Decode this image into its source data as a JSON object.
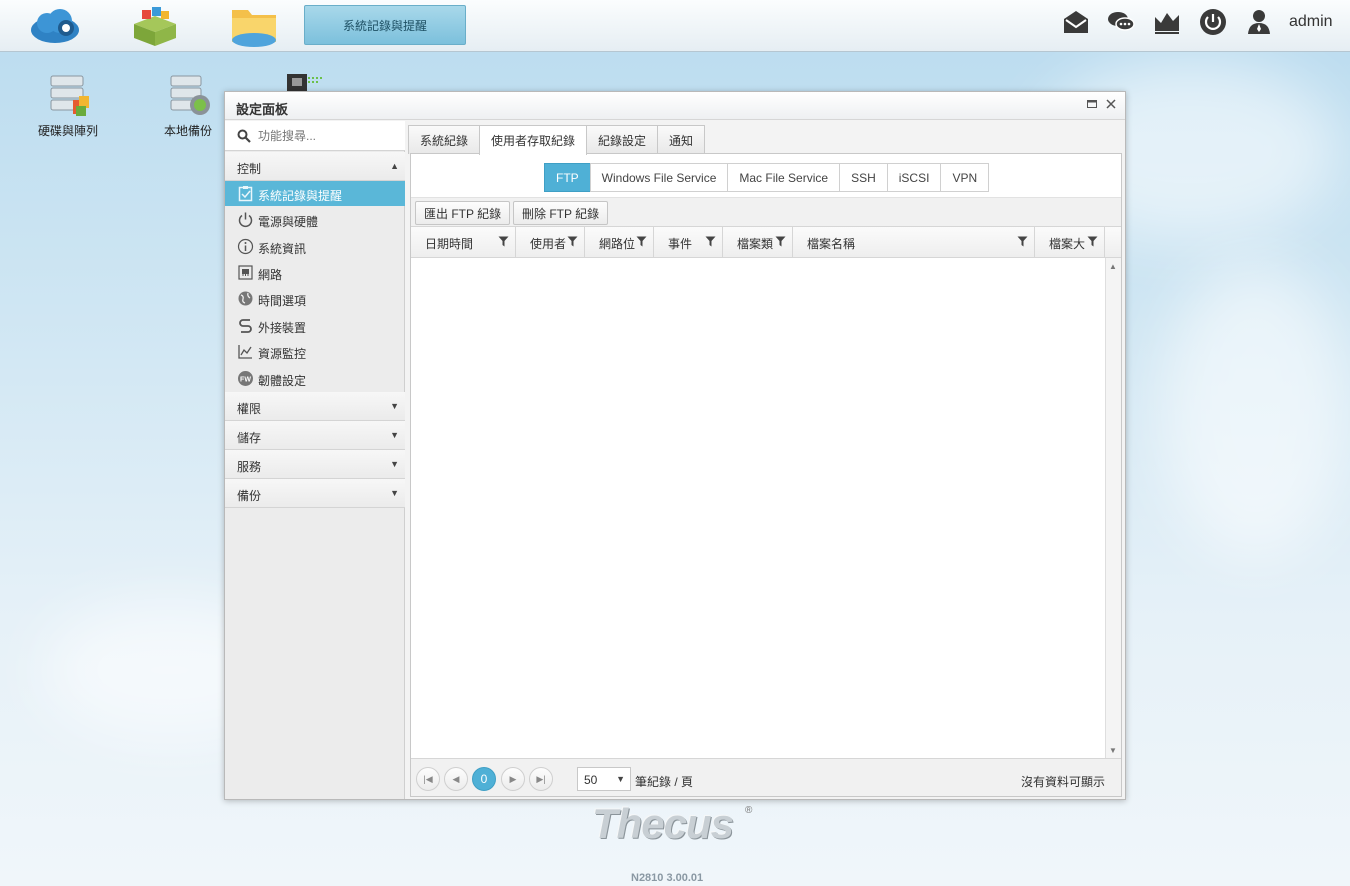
{
  "taskbar": {
    "apps": [
      {
        "name": "cloud-app-icon"
      },
      {
        "name": "app-center-icon"
      },
      {
        "name": "file-center-icon"
      }
    ],
    "active_task": "系統記錄與提醒",
    "user": "admin"
  },
  "desktop": {
    "icons": [
      {
        "label": "硬碟與陣列"
      },
      {
        "label": "本地備份"
      }
    ]
  },
  "window": {
    "title": "設定面板",
    "search_placeholder": "功能搜尋...",
    "sidebar": {
      "sections": [
        {
          "label": "控制",
          "expanded": true
        },
        {
          "label": "權限"
        },
        {
          "label": "儲存"
        },
        {
          "label": "服務"
        },
        {
          "label": "備份"
        }
      ],
      "items": [
        {
          "label": "系統記錄與提醒",
          "icon": "log-icon",
          "active": true
        },
        {
          "label": "電源與硬體",
          "icon": "power-icon"
        },
        {
          "label": "系統資訊",
          "icon": "info-icon"
        },
        {
          "label": "網路",
          "icon": "network-icon"
        },
        {
          "label": "時間選項",
          "icon": "globe-icon"
        },
        {
          "label": "外接裝置",
          "icon": "usb-icon"
        },
        {
          "label": "資源監控",
          "icon": "chart-icon"
        },
        {
          "label": "韌體設定",
          "icon": "firmware-icon"
        }
      ]
    },
    "tabs": [
      "系統紀錄",
      "使用者存取紀錄",
      "紀錄設定",
      "通知"
    ],
    "active_tab": 1,
    "subtabs": [
      "FTP",
      "Windows File Service",
      "Mac File Service",
      "SSH",
      "iSCSI",
      "VPN"
    ],
    "active_subtab": 0,
    "toolbar": {
      "export_label": "匯出 FTP 紀錄",
      "delete_label": "刪除 FTP 紀錄"
    },
    "columns": [
      "日期時間",
      "使用者",
      "網路位",
      "事件",
      "檔案類",
      "檔案名稱",
      "檔案大"
    ],
    "pager": {
      "current_page": "0",
      "page_size": "50",
      "per_page_label": "筆紀錄 / 頁",
      "status": "沒有資料可顯示"
    }
  },
  "footer": {
    "brand": "Thecus",
    "version": "N2810   3.00.01"
  },
  "colors": {
    "accent": "#4fb0d6",
    "active_nav": "#5ab7d8"
  }
}
